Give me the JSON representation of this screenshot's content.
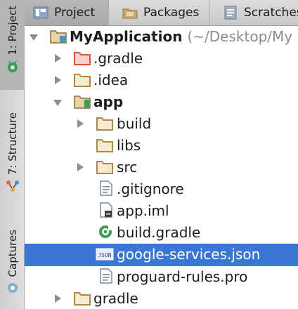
{
  "side_strip": {
    "project_label": "1: Project",
    "structure_label": "7: Structure",
    "captures_label": "Captures"
  },
  "tabs": [
    {
      "label": "Project",
      "icon": "project-icon",
      "selected": true
    },
    {
      "label": "Packages",
      "icon": "packages-icon",
      "selected": false
    },
    {
      "label": "Scratches",
      "icon": "scratches-icon",
      "selected": false
    }
  ],
  "tree": {
    "root": {
      "name": "MyApplication",
      "path_hint": "(~/Desktop/My"
    },
    "rows": [
      {
        "name": ".gradle",
        "icon": "folder-icon",
        "expanded": false
      },
      {
        "name": ".idea",
        "icon": "folder-icon",
        "expanded": false
      },
      {
        "name": "app",
        "icon": "module-folder-icon",
        "expanded": true
      },
      {
        "name": "build",
        "icon": "folder-icon",
        "expanded": false
      },
      {
        "name": "libs",
        "icon": "folder-icon"
      },
      {
        "name": "src",
        "icon": "folder-icon",
        "expanded": false
      },
      {
        "name": ".gitignore",
        "icon": "text-file-icon"
      },
      {
        "name": "app.iml",
        "icon": "iml-file-icon"
      },
      {
        "name": "build.gradle",
        "icon": "gradle-icon"
      },
      {
        "name": "google-services.json",
        "icon": "json-file-icon",
        "selected": true
      },
      {
        "name": "proguard-rules.pro",
        "icon": "text-file-icon"
      },
      {
        "name": "gradle",
        "icon": "folder-icon",
        "expanded": false
      }
    ]
  },
  "colors": {
    "selection": "#3a76d3",
    "folder": "#c8a25a",
    "gradle_folder": "#d8553d",
    "android_green": "#3d9b5a"
  }
}
